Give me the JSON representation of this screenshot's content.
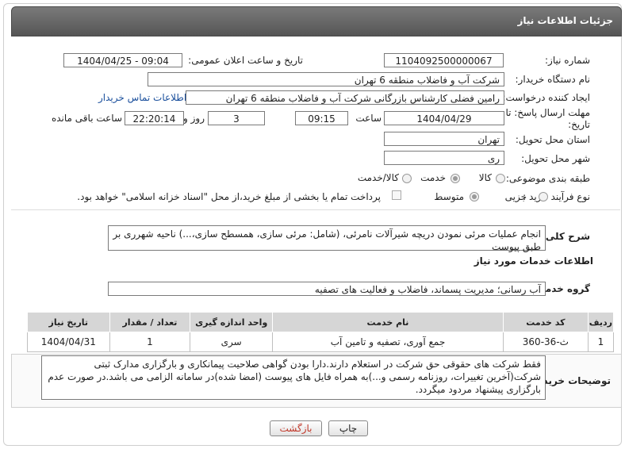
{
  "header": {
    "title": "جزئیات اطلاعات نیاز"
  },
  "form": {
    "need_number_label": "شماره نیاز:",
    "need_number": "1104092500000067",
    "announce_label": "تاریخ و ساعت اعلان عمومی:",
    "announce_value": "1404/04/25 - 09:04",
    "buyer_org_label": "نام دستگاه خریدار:",
    "buyer_org": "شرکت آب و فاضلاب منطقه 6 تهران",
    "creator_label": "ایجاد کننده درخواست:",
    "creator": "رامین  فضلی کارشناس بازرگانی شرکت آب و فاضلاب منطقه 6 تهران",
    "contact_link": "اطلاعات تماس خریدار",
    "deadline_label_1": "مهلت ارسال پاسخ: تا",
    "deadline_label_2": "تاریخ:",
    "deadline_date": "1404/04/29",
    "time_label": "ساعت",
    "deadline_time": "09:15",
    "days_value": "3",
    "days_label": "روز و",
    "remaining_time": "22:20:14",
    "remaining_label": "ساعت باقی مانده",
    "province_label": "استان محل تحویل:",
    "province": "تهران",
    "city_label": "شهر محل تحویل:",
    "city": "ری",
    "category_label": "طبقه بندی موضوعی:",
    "category_goods": "کالا",
    "category_service": "خدمت",
    "category_both": "کالا/خدمت",
    "process_label": "نوع فرآیند خرید :",
    "process_partial": "جزیی",
    "process_medium": "متوسط",
    "payment_note": "پرداخت تمام یا بخشی از مبلغ خرید،از محل \"اسناد خزانه اسلامی\" خواهد بود."
  },
  "description": {
    "label": "شرح کلی نیاز:",
    "text": "انجام عملیات مرئی نمودن دریچه شیرآلات نامرئی، (شامل: مرئی سازی، همسطح سازی،...) ناحیه شهرری بر طبق پیوست"
  },
  "services": {
    "section_title": "اطلاعات خدمات مورد نیاز",
    "group_label": "گروه خدمت:",
    "group_value": "آب رسانی؛ مدیریت پسماند، فاضلاب و فعالیت های تصفیه",
    "columns": [
      "ردیف",
      "کد خدمت",
      "نام خدمت",
      "واحد اندازه گیری",
      "تعداد / مقدار",
      "تاریخ نیاز"
    ],
    "rows": [
      [
        "1",
        "ث-36-360",
        "جمع آوری، تصفیه و تامین آب",
        "سری",
        "1",
        "1404/04/31"
      ]
    ]
  },
  "buyer_notes": {
    "label": "توضیحات خریدار:",
    "text": "فقط شرکت های حقوقی حق شرکت در استعلام دارند.دارا بودن گواهی صلاحیت پیمانکاری و بارگزاری مدارک ثبتی شرکت(آخرین تغییرات، روزنامه رسمی و...)به همراه فایل های پیوست (امضا شده)در سامانه الزامی می باشد.در صورت عدم بارگزاری پیشنهاد مردود میگردد."
  },
  "buttons": {
    "print": "چاپ",
    "back": "بازگشت"
  },
  "colors": {
    "header_bg": "#5f5f5f",
    "link": "#1a4f9c",
    "back_text": "#c0392b"
  }
}
